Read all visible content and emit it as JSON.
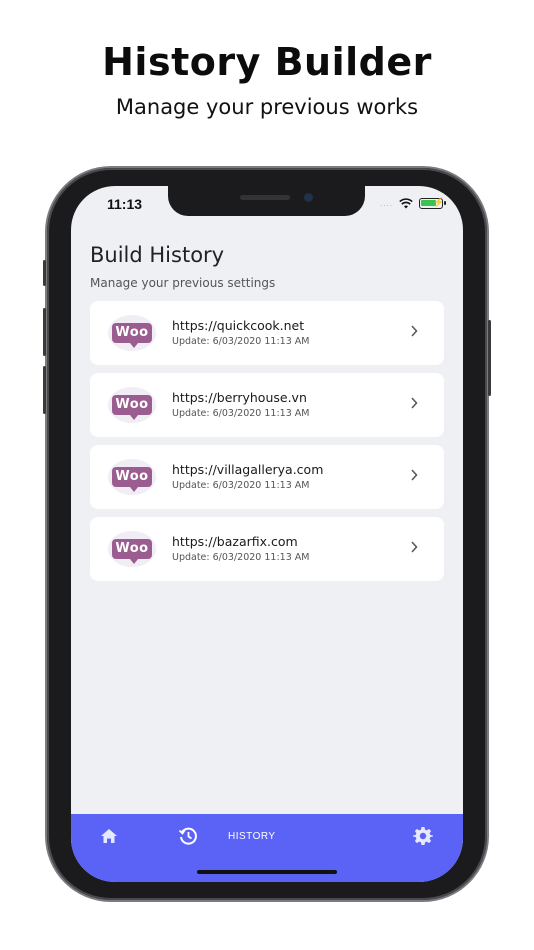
{
  "promo": {
    "title": "History Builder",
    "subtitle": "Manage your previous works"
  },
  "status_bar": {
    "time": "11:13",
    "signal": "....",
    "wifi_icon": "wifi-icon",
    "battery_icon": "battery-charging-icon"
  },
  "page": {
    "title": "Build History",
    "subtitle": "Manage your previous settings"
  },
  "history_items": [
    {
      "logo_text": "Woo",
      "url": "https://quickcook.net",
      "updated": "Update: 6/03/2020 11:13 AM"
    },
    {
      "logo_text": "Woo",
      "url": "https://berryhouse.vn",
      "updated": "Update: 6/03/2020 11:13 AM"
    },
    {
      "logo_text": "Woo",
      "url": "https://villagallerya.com",
      "updated": "Update: 6/03/2020 11:13 AM"
    },
    {
      "logo_text": "Woo",
      "url": "https://bazarfix.com",
      "updated": "Update: 6/03/2020 11:13 AM"
    }
  ],
  "tab_bar": {
    "home_icon": "home-icon",
    "history_icon": "history-icon",
    "history_label": "HISTORY",
    "settings_icon": "gear-icon",
    "active_tab": "HISTORY"
  },
  "colors": {
    "accent": "#5b63f7",
    "woo_purple": "#9b5c8f",
    "background": "#eef0f3",
    "card": "#ffffff"
  }
}
